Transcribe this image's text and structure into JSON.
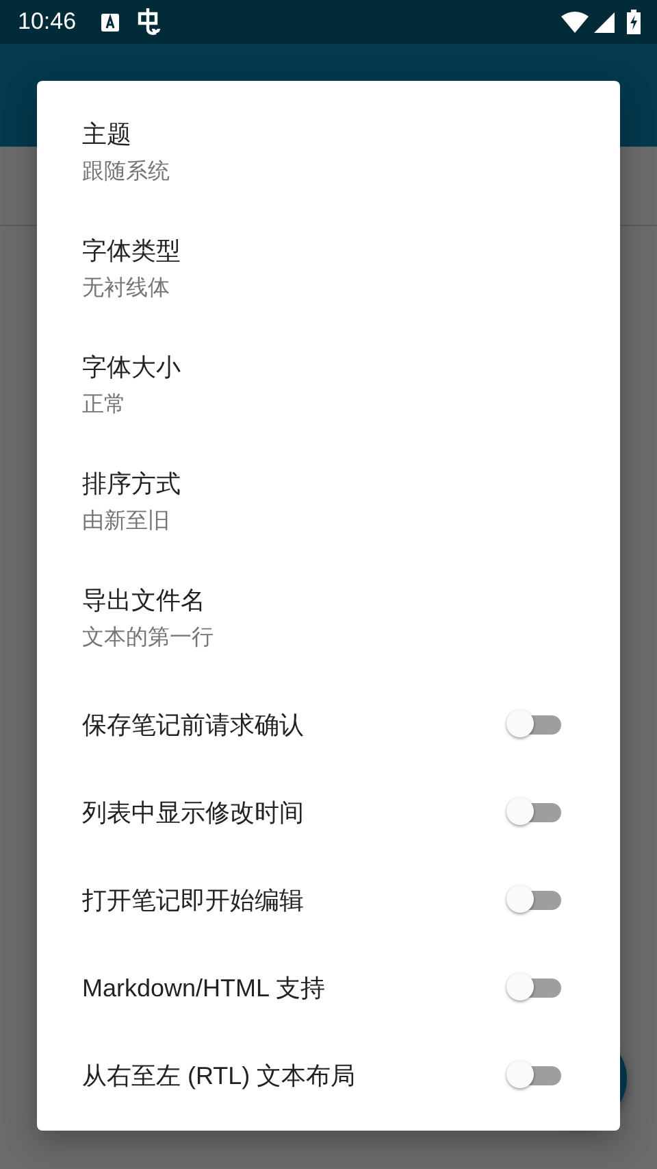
{
  "status_bar": {
    "time": "10:46"
  },
  "dialog": {
    "items": [
      {
        "kind": "choice",
        "title": "主题",
        "value": "跟随系统"
      },
      {
        "kind": "choice",
        "title": "字体类型",
        "value": "无衬线体"
      },
      {
        "kind": "choice",
        "title": "字体大小",
        "value": "正常"
      },
      {
        "kind": "choice",
        "title": "排序方式",
        "value": "由新至旧"
      },
      {
        "kind": "choice",
        "title": "导出文件名",
        "value": "文本的第一行"
      },
      {
        "kind": "switch",
        "title": "保存笔记前请求确认",
        "on": false
      },
      {
        "kind": "switch",
        "title": "列表中显示修改时间",
        "on": false
      },
      {
        "kind": "switch",
        "title": "打开笔记即开始编辑",
        "on": false
      },
      {
        "kind": "switch",
        "title": "Markdown/HTML 支持",
        "on": false
      },
      {
        "kind": "switch",
        "title": "从右至左 (RTL) 文本布局",
        "on": false
      }
    ]
  }
}
